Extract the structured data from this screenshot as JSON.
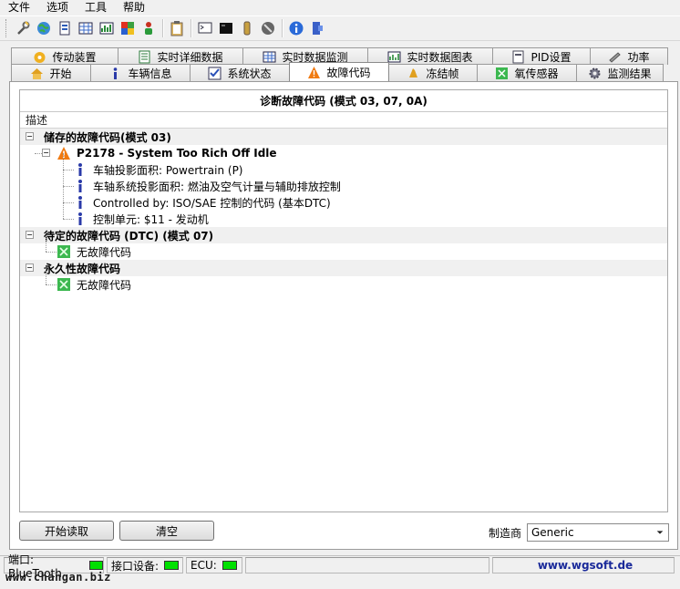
{
  "menu": [
    "文件",
    "选项",
    "工具",
    "帮助"
  ],
  "toolbar_icons": [
    "wrench-icon",
    "globe-icon",
    "document-icon",
    "grid-icon",
    "chart-icon",
    "flag-icon",
    "person-icon",
    "clipboard-icon",
    "terminal-icon",
    "console-icon",
    "battery-icon",
    "stop-icon",
    "info-icon",
    "exit-icon"
  ],
  "tabs_back": [
    {
      "label": "传动装置",
      "icon": "transmission-icon"
    },
    {
      "label": "实时详细数据",
      "icon": "list-icon"
    },
    {
      "label": "实时数据监测",
      "icon": "grid-icon"
    },
    {
      "label": "实时数据图表",
      "icon": "chart-icon"
    },
    {
      "label": "PID设置",
      "icon": "pid-icon"
    },
    {
      "label": "功率",
      "icon": "power-icon"
    }
  ],
  "tabs_front": [
    {
      "label": "开始",
      "icon": "home-icon"
    },
    {
      "label": "车辆信息",
      "icon": "info-icon"
    },
    {
      "label": "系统状态",
      "icon": "checkbox-icon"
    },
    {
      "label": "故障代码",
      "icon": "warning-icon",
      "active": true
    },
    {
      "label": "冻结帧",
      "icon": "freeze-icon"
    },
    {
      "label": "氧传感器",
      "icon": "sensor-icon"
    },
    {
      "label": "监测结果",
      "icon": "gear-icon"
    }
  ],
  "panel_title": "诊断故障代码 (模式 03, 07, 0A)",
  "column_header": "描述",
  "tree": {
    "stored": {
      "label": "储存的故障代码(模式 03)",
      "code": "P2178 - System Too Rich Off Idle",
      "details": [
        "车轴投影面积: Powertrain (P)",
        "车轴系统投影面积: 燃油及空气计量与辅助排放控制",
        "Controlled by: ISO/SAE 控制的代码 (基本DTC)",
        "控制单元: $11 - 发动机"
      ]
    },
    "pending": {
      "label": "待定的故障代码 (DTC) (模式 07)",
      "item": "无故障代码"
    },
    "permanent": {
      "label": "永久性故障代码",
      "item": "无故障代码"
    }
  },
  "buttons": {
    "start_read": "开始读取",
    "clear": "清空"
  },
  "vendor": {
    "label": "制造商",
    "value": "Generic"
  },
  "status": {
    "port_label": "端口: BlueTooth",
    "interface_label": "接口设备:",
    "ecu_label": "ECU:",
    "website": "www.wgsoft.de"
  },
  "watermark": "www.changan.biz",
  "colors": {
    "led_green": "#00e000",
    "website": "#1a2a9a",
    "warning": "#f07a10"
  }
}
